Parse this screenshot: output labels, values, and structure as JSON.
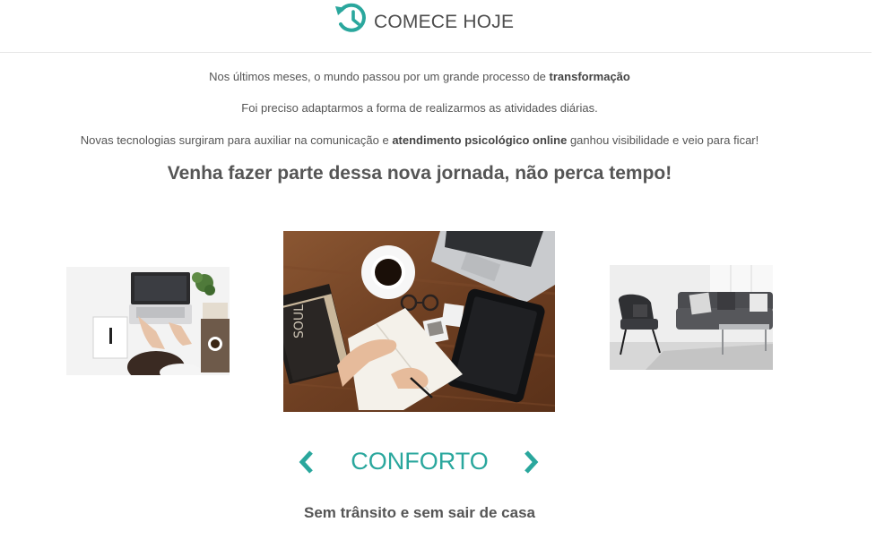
{
  "header": {
    "title": "COMECE HOJE",
    "icon": "history-clock-icon"
  },
  "intro": {
    "line1": {
      "pre": "Nos últimos meses, o mundo passou por um grande processo de ",
      "bold": "transformação"
    },
    "line2": "Foi preciso adaptarmos a forma de realizarmos as atividades diárias.",
    "line3": {
      "pre": "Novas tecnologias surgiram para auxiliar na comunicação e ",
      "bold": "atendimento psicológico online",
      "post": " ganhou visibilidade e veio para ficar!"
    }
  },
  "cta": "Venha fazer parte dessa nova jornada, não perca tempo!",
  "carousel": {
    "slides": [
      {
        "image": "laptop-desk-photo"
      },
      {
        "image": "writing-notebook-coffee-photo"
      },
      {
        "image": "living-room-armchair-sofa-photo"
      }
    ],
    "prev_icon": "chevron-left-icon",
    "next_icon": "chevron-right-icon",
    "active_title": "CONFORTO",
    "active_subtitle": "Sem trânsito e sem sair de casa"
  },
  "colors": {
    "accent": "#2aa79d",
    "text": "#555555",
    "divider": "#e6e6e6"
  }
}
